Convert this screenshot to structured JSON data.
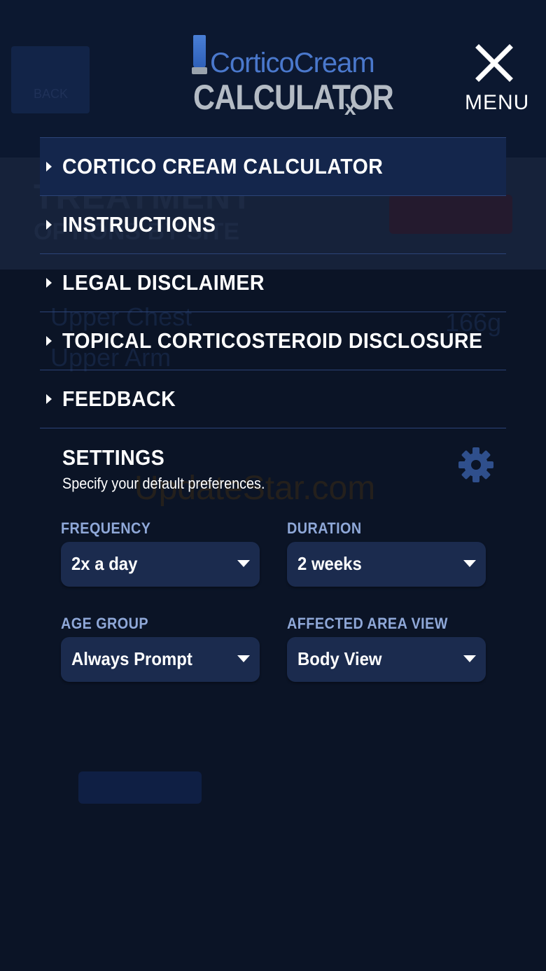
{
  "header": {
    "brand_line1": "CorticoCream",
    "brand_line2": "CALCULATOR",
    "brand_suffix": "x",
    "close_label": "MENU",
    "close_icon": "close-icon"
  },
  "menu": {
    "items": [
      {
        "label": "CORTICO CREAM CALCULATOR",
        "active": true
      },
      {
        "label": "INSTRUCTIONS",
        "active": false
      },
      {
        "label": "LEGAL DISCLAIMER",
        "active": false
      },
      {
        "label": "TOPICAL CORTICOSTEROID DISCLOSURE",
        "active": false
      },
      {
        "label": "FEEDBACK",
        "active": false
      }
    ]
  },
  "settings": {
    "title": "SETTINGS",
    "subtitle": "Specify your default preferences.",
    "icon": "gear-icon",
    "fields": {
      "frequency": {
        "label": "FREQUENCY",
        "value": "2x a day"
      },
      "duration": {
        "label": "DURATION",
        "value": "2 weeks"
      },
      "age_group": {
        "label": "AGE GROUP",
        "value": "Always Prompt"
      },
      "affected_area_view": {
        "label": "AFFECTED AREA VIEW",
        "value": "Body View"
      }
    }
  },
  "background": {
    "back_label": "BACK",
    "title_line1": "TREATMENT",
    "title_line2": "OPTIONS BY SITE",
    "rows": [
      {
        "label": "Upper Chest",
        "value": "166g"
      },
      {
        "label": "Upper Arm",
        "value": ""
      }
    ],
    "watermark": "UpdateStar.com"
  },
  "colors": {
    "background": "#0b1426",
    "menu_active": "#14264c",
    "divider": "#2c4478",
    "field_label": "#8fa8d8",
    "select_bg": "#1b2b4e",
    "brand_blue": "#4a78cc",
    "brand_gray": "#b4bbc4"
  }
}
